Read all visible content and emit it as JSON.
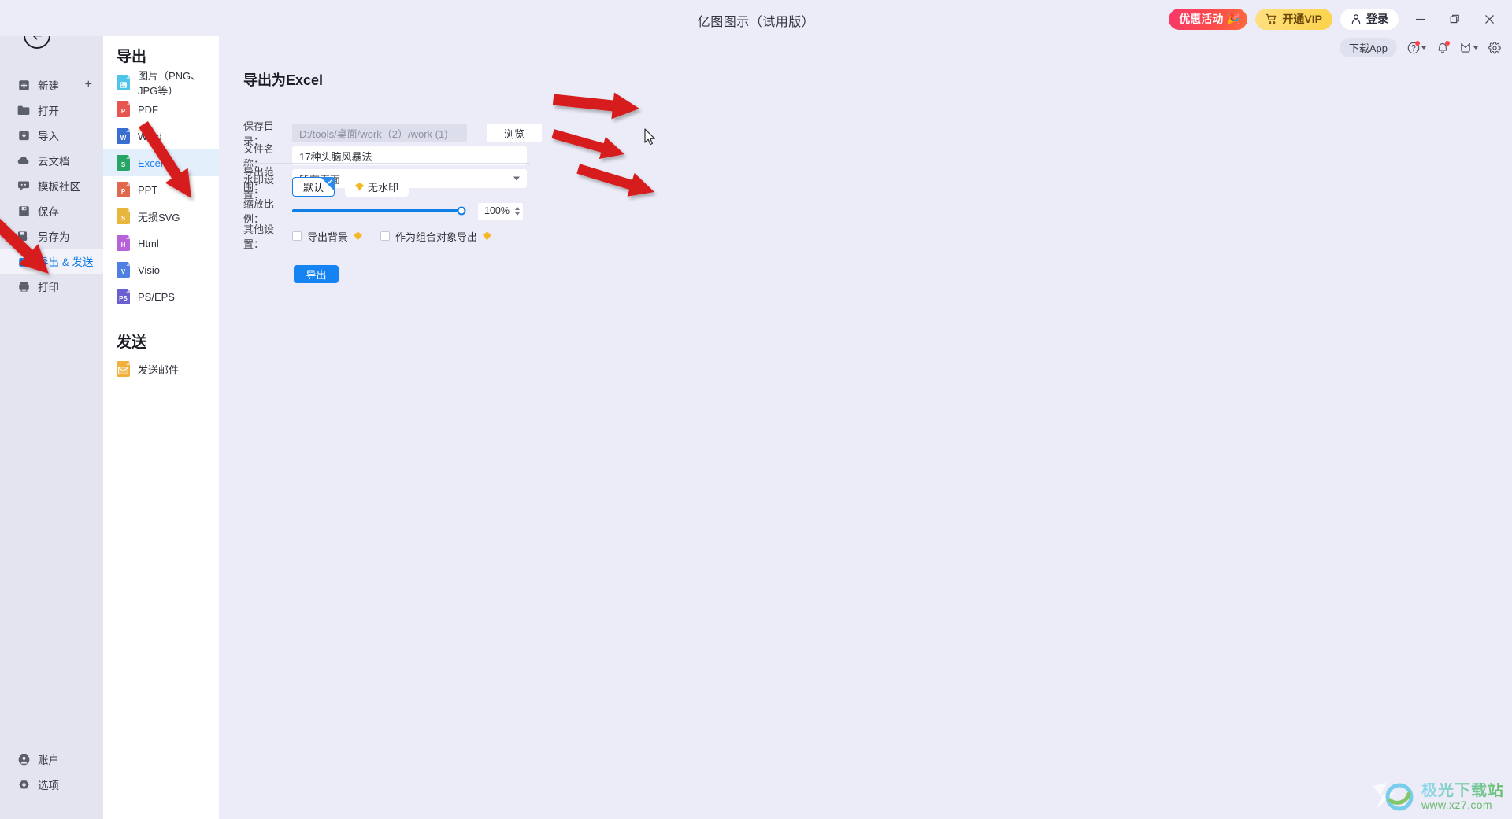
{
  "window": {
    "title": "亿图图示（试用版）",
    "promo_label": "优惠活动",
    "vip_label": "开通VIP",
    "login_label": "登录",
    "minimize_icon": "minimize-icon",
    "maximize_icon": "maximize-icon",
    "close_icon": "close-icon"
  },
  "toolbar2": {
    "download_app": "下载App",
    "help_icon": "help-icon",
    "bell_icon": "notification-bell-icon",
    "gift_icon": "gift-icon",
    "settings_icon": "gear-icon"
  },
  "rail": {
    "back_icon": "back-arrow-icon",
    "items": [
      {
        "label": "新建",
        "icon": "plus-square-icon",
        "trailing": "+"
      },
      {
        "label": "打开",
        "icon": "folder-icon"
      },
      {
        "label": "导入",
        "icon": "import-icon"
      },
      {
        "label": "云文档",
        "icon": "cloud-icon"
      },
      {
        "label": "模板社区",
        "icon": "community-icon"
      },
      {
        "label": "保存",
        "icon": "save-icon"
      },
      {
        "label": "另存为",
        "icon": "save-as-icon"
      },
      {
        "label": "导出 & 发送",
        "icon": "export-icon",
        "active": true
      },
      {
        "label": "打印",
        "icon": "printer-icon"
      }
    ],
    "bottom_items": [
      {
        "label": "账户",
        "icon": "account-icon"
      },
      {
        "label": "选项",
        "icon": "gear-icon"
      }
    ]
  },
  "export_panel": {
    "title": "导出",
    "formats": [
      {
        "label": "图片（PNG、JPG等）",
        "badge": "I",
        "color": "#4fc3e8"
      },
      {
        "label": "PDF",
        "badge": "P",
        "color": "#e8544f"
      },
      {
        "label": "Word",
        "badge": "W",
        "color": "#3a6ed0"
      },
      {
        "label": "Excel",
        "badge": "S",
        "color": "#27a567",
        "active": true
      },
      {
        "label": "PPT",
        "badge": "P",
        "color": "#e0684c"
      },
      {
        "label": "无损SVG",
        "badge": "S",
        "color": "#e8b63c"
      },
      {
        "label": "Html",
        "badge": "H",
        "color": "#b862d9"
      },
      {
        "label": "Visio",
        "badge": "V",
        "color": "#4f7fe0"
      },
      {
        "label": "PS/EPS",
        "badge": "PS",
        "color": "#6a5fd0"
      }
    ],
    "send_title": "发送",
    "send_items": [
      {
        "label": "发送邮件",
        "icon": "mail-icon",
        "color": "#f0b03c"
      }
    ]
  },
  "form": {
    "heading": "导出为Excel",
    "save_dir_label": "保存目录：",
    "save_dir_value": "D:/tools/桌面/work（2）/work (1)",
    "browse_label": "浏览",
    "file_name_label": "文件名称：",
    "file_name_value": "17种头脑风暴法",
    "export_range_label": "导出范围：",
    "export_range_value": "所有页面",
    "watermark_label": "水印设置：",
    "watermark_options": [
      {
        "label": "默认",
        "selected": true
      },
      {
        "label": "无水印",
        "vip": true
      }
    ],
    "zoom_label": "缩放比例：",
    "zoom_value": "100%",
    "zoom_percent": 100,
    "other_label": "其他设置：",
    "other_options": [
      {
        "label": "导出背景",
        "checked": false,
        "vip": true
      },
      {
        "label": "作为组合对象导出",
        "checked": false,
        "vip": true
      }
    ],
    "export_button": "导出"
  },
  "watermark_brand": {
    "name": "极光下载站",
    "url": "www.xz7.com"
  },
  "annotations": {
    "arrow_count": 5,
    "color": "#d61f1f"
  }
}
